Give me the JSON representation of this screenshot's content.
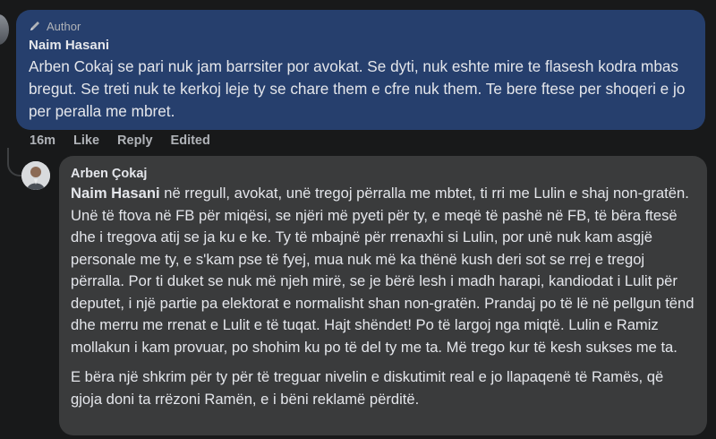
{
  "comment1": {
    "badge": "Author",
    "author": "Naim Hasani",
    "text": "Arben Cokaj se pari nuk jam barrsiter por avokat. Se dyti, nuk eshte mire te flasesh kodra mbas bregut. Se treti nuk te kerkoj leje ty se chare them e cfre nuk them. Te bere ftese per shoqeri e jo per peralla me mbret.",
    "actions": {
      "time": "16m",
      "like": "Like",
      "reply": "Reply",
      "edited": "Edited"
    }
  },
  "comment2": {
    "author": "Arben Çokaj",
    "mention": "Naim Hasani",
    "text": " në rregull, avokat, unë tregoj përralla me mbtet, ti rri me Lulin e shaj non-gratën. Unë të ftova në FB për miqësi, se njëri më pyeti për ty, e meqë të pashë në FB, të bëra ftesë dhe i tregova atij se ja ku e ke. Ty të mbajnë për rrenaxhi si Lulin, por unë nuk kam asgjë personale me ty, e s'kam pse të fyej, mua nuk më ka thënë kush deri sot se rrej e tregoj përralla. Por ti duket se nuk më njeh mirë, se je bërë lesh i madh harapi, kandiodat i Lulit për deputet, i një partie pa elektorat e normalisht shan non-gratën. Prandaj po të lë në pellgun tënd dhe merru me rrenat e Lulit e të tuqat. Hajt shëndet! Po të largoj nga miqtë. Lulin e Ramiz mollakun i kam provuar, po shohim ku po të del ty me ta. Më trego kur të kesh sukses me ta.",
    "text2": "E bëra një shkrim për ty për të treguar nivelin e diskutimit real e jo llapaqenë të Ramës, që gjoja doni ta rrëzoni Ramën, e i bëni reklamë përditë."
  },
  "colors": {
    "background": "#18191a",
    "author_bubble": "#263f6d",
    "reply_bubble": "#3a3b3c",
    "text": "#e4e6eb",
    "secondary_text": "#b0b3b8"
  }
}
